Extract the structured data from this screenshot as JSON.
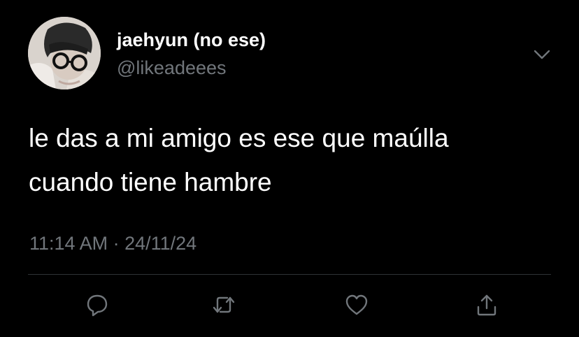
{
  "tweet": {
    "author": {
      "display_name": "jaehyun (no ese)",
      "handle": "@likeadeees",
      "avatar": "profile-photo"
    },
    "text_lines": [
      "le das a mi amigo es ese que maúlla",
      "cuando tiene hambre"
    ],
    "timestamp": "11:14 AM · 24/11/24",
    "menu_icon": "chevron-down-icon",
    "actions": [
      {
        "name": "reply",
        "icon": "reply-icon"
      },
      {
        "name": "retweet",
        "icon": "retweet-icon"
      },
      {
        "name": "like",
        "icon": "heart-icon"
      },
      {
        "name": "share",
        "icon": "share-icon"
      }
    ]
  },
  "colors": {
    "background": "#000000",
    "primary_text": "#ffffff",
    "secondary_text": "#71767b",
    "divider": "#2f3336",
    "icon": "#71767b"
  }
}
